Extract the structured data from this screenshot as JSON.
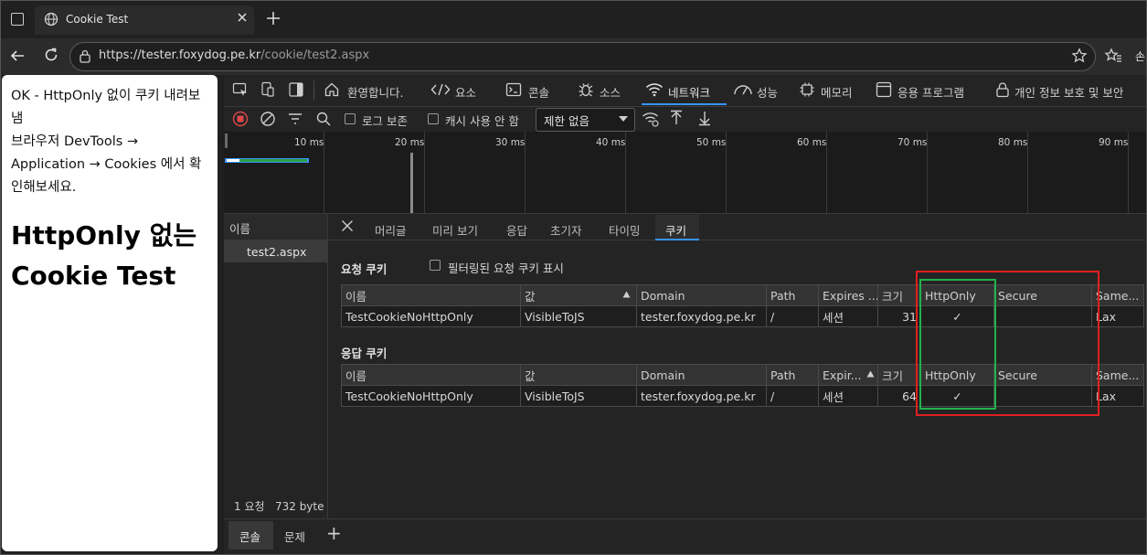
{
  "browser": {
    "tab_title": "Cookie Test",
    "url_host": "https://tester.foxydog.pe.kr",
    "url_path": "/cookie/test2.aspx",
    "profile_label": "손"
  },
  "page": {
    "paragraph": "OK - HttpOnly 없이 쿠키 내려보냄\n브라우저 DevTools → Application → Cookies 에서 확인해보세요.",
    "heading": "HttpOnly 없는 Cookie Test"
  },
  "devtools": {
    "tabs": [
      {
        "label": "환영합니다.",
        "icon": "home-icon"
      },
      {
        "label": "요소",
        "icon": "code-icon"
      },
      {
        "label": "콘솔",
        "icon": "console-icon"
      },
      {
        "label": "소스",
        "icon": "bug-icon"
      },
      {
        "label": "네트워크",
        "icon": "wifi-icon"
      },
      {
        "label": "성능",
        "icon": "gauge-icon"
      },
      {
        "label": "메모리",
        "icon": "chip-icon"
      },
      {
        "label": "응용 프로그램",
        "icon": "app-icon"
      },
      {
        "label": "개인 정보 보호 및 보안",
        "icon": "lock-icon"
      }
    ],
    "toolbar": {
      "preserve_log": "로그 보존",
      "disable_cache": "캐시 사용 안 함",
      "throttle": "제한 없음"
    },
    "timeline_ticks": [
      "10 ms",
      "20 ms",
      "30 ms",
      "40 ms",
      "50 ms",
      "60 ms",
      "70 ms",
      "80 ms",
      "90 ms"
    ],
    "name_panel": {
      "header": "이름",
      "row": "test2.aspx",
      "status": "1 요청   732 byte"
    },
    "detail_tabs": [
      "머리글",
      "미리 보기",
      "응답",
      "초기자",
      "타이밍",
      "쿠키"
    ],
    "request_cookies": {
      "title": "요청 쿠키",
      "filter_label": "필터링된 요청 쿠키 표시",
      "headers": [
        "이름",
        "값",
        "Domain",
        "Path",
        "Expires ...",
        "크기",
        "HttpOnly",
        "Secure",
        "Same..."
      ],
      "row": [
        "TestCookieNoHttpOnly",
        "VisibleToJS",
        "tester.foxydog.pe.kr",
        "/",
        "세션",
        "31",
        "✓",
        "",
        "Lax"
      ]
    },
    "response_cookies": {
      "title": "응답 쿠키",
      "headers": [
        "이름",
        "값",
        "Domain",
        "Path",
        "Expir...",
        "크기",
        "HttpOnly",
        "Secure",
        "Same..."
      ],
      "row": [
        "TestCookieNoHttpOnly",
        "VisibleToJS",
        "tester.foxydog.pe.kr",
        "/",
        "세션",
        "64",
        "✓",
        "",
        "Lax"
      ]
    },
    "drawer": {
      "console": "콘솔",
      "issues": "문제",
      "add": "+"
    }
  },
  "colors": {
    "accent": "#3794ff",
    "highlight_red": "#e02020",
    "highlight_green": "#23b14d",
    "recording_red": "#e04848",
    "waterfall_green": "#2ea043",
    "waterfall_blue": "#3794ff"
  }
}
